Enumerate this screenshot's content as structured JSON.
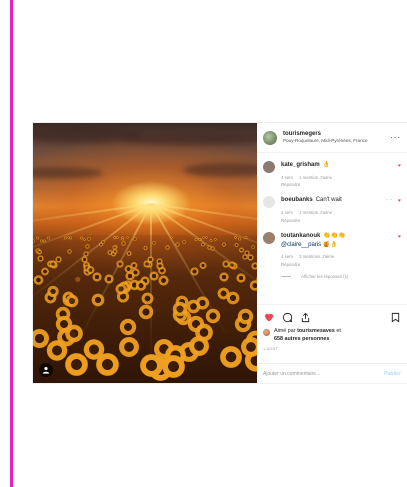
{
  "post": {
    "username": "tourismegers",
    "location": "Pouy-Roquelaure, Midi-Pyrénées, France",
    "more_label": "···",
    "comments": [
      {
        "user": "kate_grisham",
        "text": "👌",
        "time": "4 sem",
        "likes": "1 mention J'aime",
        "reply": "Répondre",
        "avatar_color": "#8a7a72"
      },
      {
        "user": "boeubanks",
        "text": "Can't wait",
        "time": "4 sem",
        "likes": "1 mention J'aime",
        "reply": "Répondre",
        "avatar_color": "#e6e6e6"
      },
      {
        "user": "toutankanouk",
        "text": "👏👏👏",
        "mention": "@claire__paris",
        "mention_suffix": "🍯👌",
        "time": "4 sem",
        "likes": "3 mentions J'aime",
        "reply": "Répondre",
        "avatar_color": "#9a7f6b"
      }
    ],
    "view_replies": "Afficher les réponses (1)",
    "liked_by_prefix": "Aimé par",
    "liked_by_user": "tourismesaves",
    "liked_by_connector": "et",
    "liked_by_others": "658 autres personnes",
    "date": "1 AOÛT",
    "comment_placeholder": "Ajouter un commentaire...",
    "publish_label": "Publier",
    "icons": [
      "heart-icon",
      "comment-icon",
      "share-icon",
      "bookmark-icon",
      "user-icon"
    ],
    "colors": {
      "accent_bar": "#e020c8",
      "heart": "#ed4956",
      "publish": "#b2dffc",
      "mention": "#003569"
    }
  }
}
